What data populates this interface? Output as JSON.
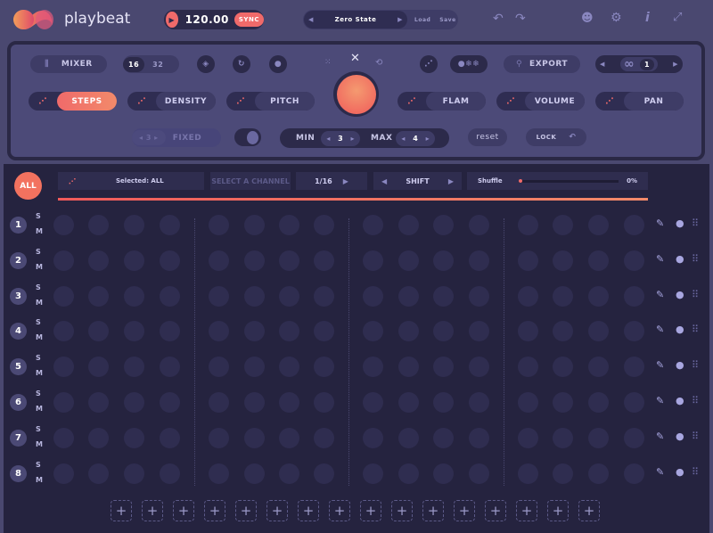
{
  "header": {
    "app_name": "playbeat",
    "tempo": "120.00",
    "sync_label": "SYNC",
    "preset": "Zero State",
    "load_label": "Load",
    "save_label": "Save"
  },
  "panel": {
    "mixer_label": "MIXER",
    "steps_16": "16",
    "steps_32": "32",
    "export_label": "EXPORT",
    "loop_count": "1",
    "params": [
      "STEPS",
      "DENSITY",
      "PITCH",
      "FLAM",
      "VOLUME",
      "PAN"
    ],
    "fixed_value": "3",
    "fixed_label": "FIXED",
    "min_label": "MIN",
    "min_value": "3",
    "max_label": "MAX",
    "max_value": "4",
    "reset_label": "reset",
    "lock_label": "LOCK"
  },
  "controls": {
    "all_label": "ALL",
    "selected": "Selected: ALL",
    "select_channel": "SELECT A CHANNEL",
    "resolution": "1/16",
    "shift_label": "SHIFT",
    "shuffle_label": "Shuffle",
    "shuffle_value": "0%",
    "shuffle_fraction": 0
  },
  "channels": [
    "1",
    "2",
    "3",
    "4",
    "5",
    "6",
    "7",
    "8"
  ],
  "solo_label": "S",
  "mute_label": "M",
  "steps_per_row": 16,
  "add_buttons": 16,
  "accent": "#f06a6a"
}
